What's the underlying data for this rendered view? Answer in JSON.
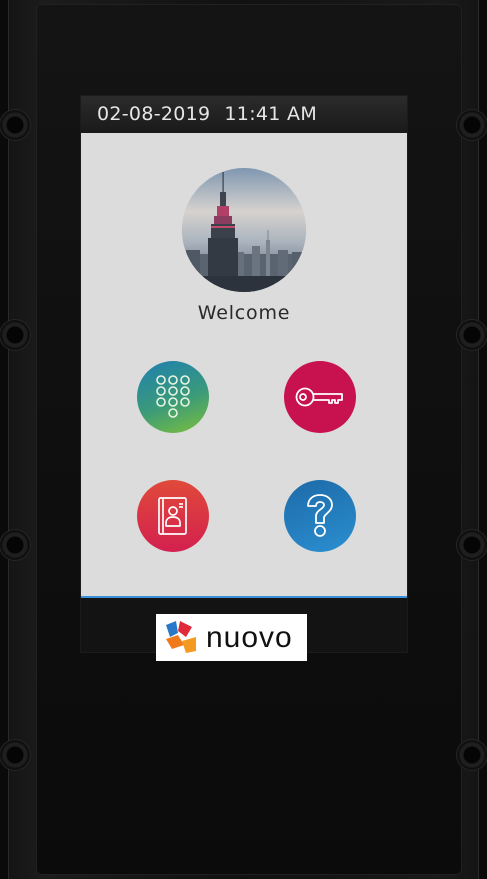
{
  "status_bar": {
    "date": "02-08-2019",
    "time": "11:41 AM"
  },
  "profile": {
    "greeting": "Welcome",
    "avatar_icon": "city-skyline-photo"
  },
  "apps": [
    {
      "id": "keypad",
      "icon": "keypad-icon",
      "color": "#3a9a7a"
    },
    {
      "id": "key",
      "icon": "key-icon",
      "color": "#c8124f"
    },
    {
      "id": "contacts",
      "icon": "contacts-book-icon",
      "color": "#d3204f"
    },
    {
      "id": "help",
      "icon": "question-mark-icon",
      "color": "#2a8fd0"
    }
  ],
  "brand": {
    "name": "nuovo",
    "accent": "#3a8fd8"
  }
}
